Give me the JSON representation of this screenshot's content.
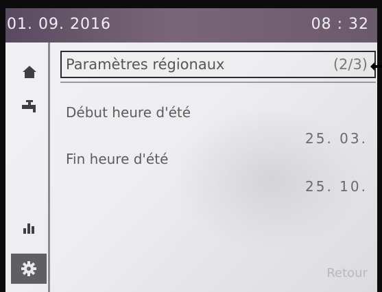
{
  "status": {
    "date": "01. 09. 2016",
    "time": "08 : 32"
  },
  "sidebar": {
    "icons": [
      "home-icon",
      "tap-icon",
      "stats-icon",
      "settings-icon"
    ],
    "active": "settings-icon"
  },
  "menu": {
    "title": "Paramètres régionaux",
    "page": "(2/3)"
  },
  "fields": [
    {
      "label": "Début heure d'été",
      "value": "25. 03."
    },
    {
      "label": "Fin heure d'été",
      "value": "25. 10."
    }
  ],
  "footer": {
    "back_label": "Retour"
  }
}
